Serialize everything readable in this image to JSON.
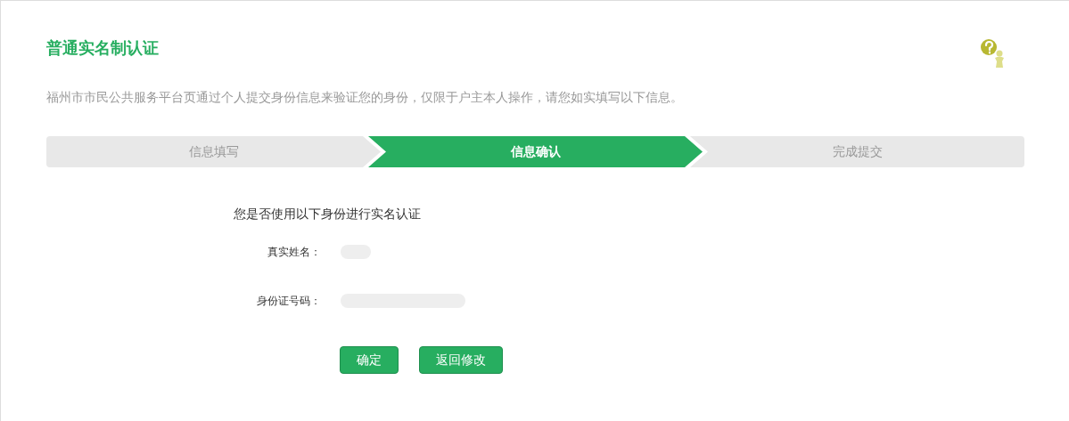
{
  "title": "普通实名制认证",
  "description": "福州市市民公共服务平台页通过个人提交身份信息来验证您的身份，仅限于户主本人操作，请您如实填写以下信息。",
  "steps": [
    {
      "label": "信息填写",
      "selected": false
    },
    {
      "label": "信息确认",
      "selected": true
    },
    {
      "label": "完成提交",
      "selected": false
    }
  ],
  "question": "您是否使用以下身份进行实名认证",
  "fields": [
    {
      "label": "真实姓名："
    },
    {
      "label": "身份证号码："
    }
  ],
  "buttons": [
    {
      "label": "确定"
    },
    {
      "label": "返回修改"
    }
  ]
}
